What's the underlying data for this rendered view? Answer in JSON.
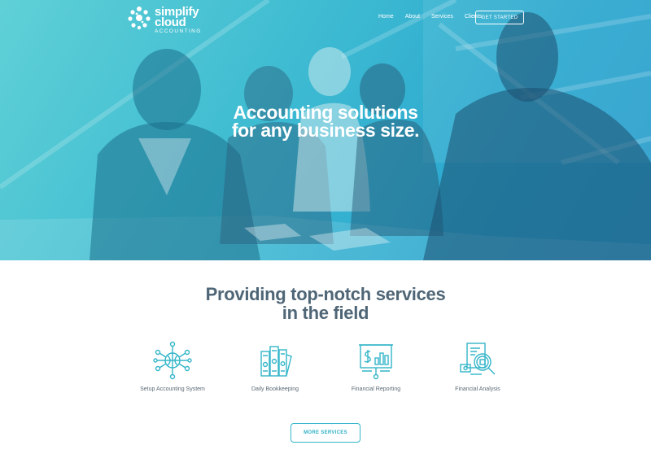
{
  "brand": {
    "line1": "simplify",
    "line2": "cloud",
    "line3": "ACCOUNTING"
  },
  "nav": {
    "items": [
      "Home",
      "About",
      "Services",
      "Clients"
    ],
    "cta": "GET STARTED"
  },
  "hero": {
    "headline_line1": "Accounting solutions",
    "headline_line2": "for any business size."
  },
  "services": {
    "title_line1": "Providing top-notch services",
    "title_line2": "in the field",
    "items": [
      {
        "label": "Setup Accounting System",
        "icon": "network-globe-icon"
      },
      {
        "label": "Daily Bookkeeping",
        "icon": "ledger-books-icon"
      },
      {
        "label": "Financial Reporting",
        "icon": "presentation-board-icon"
      },
      {
        "label": "Financial Analysis",
        "icon": "document-magnifier-icon"
      }
    ],
    "more_button": "MORE SERVICES"
  },
  "colors": {
    "accent": "#33b5c9",
    "hero_start": "#5fd0d6",
    "hero_end": "#2a9ccc",
    "heading": "#4f6677"
  }
}
